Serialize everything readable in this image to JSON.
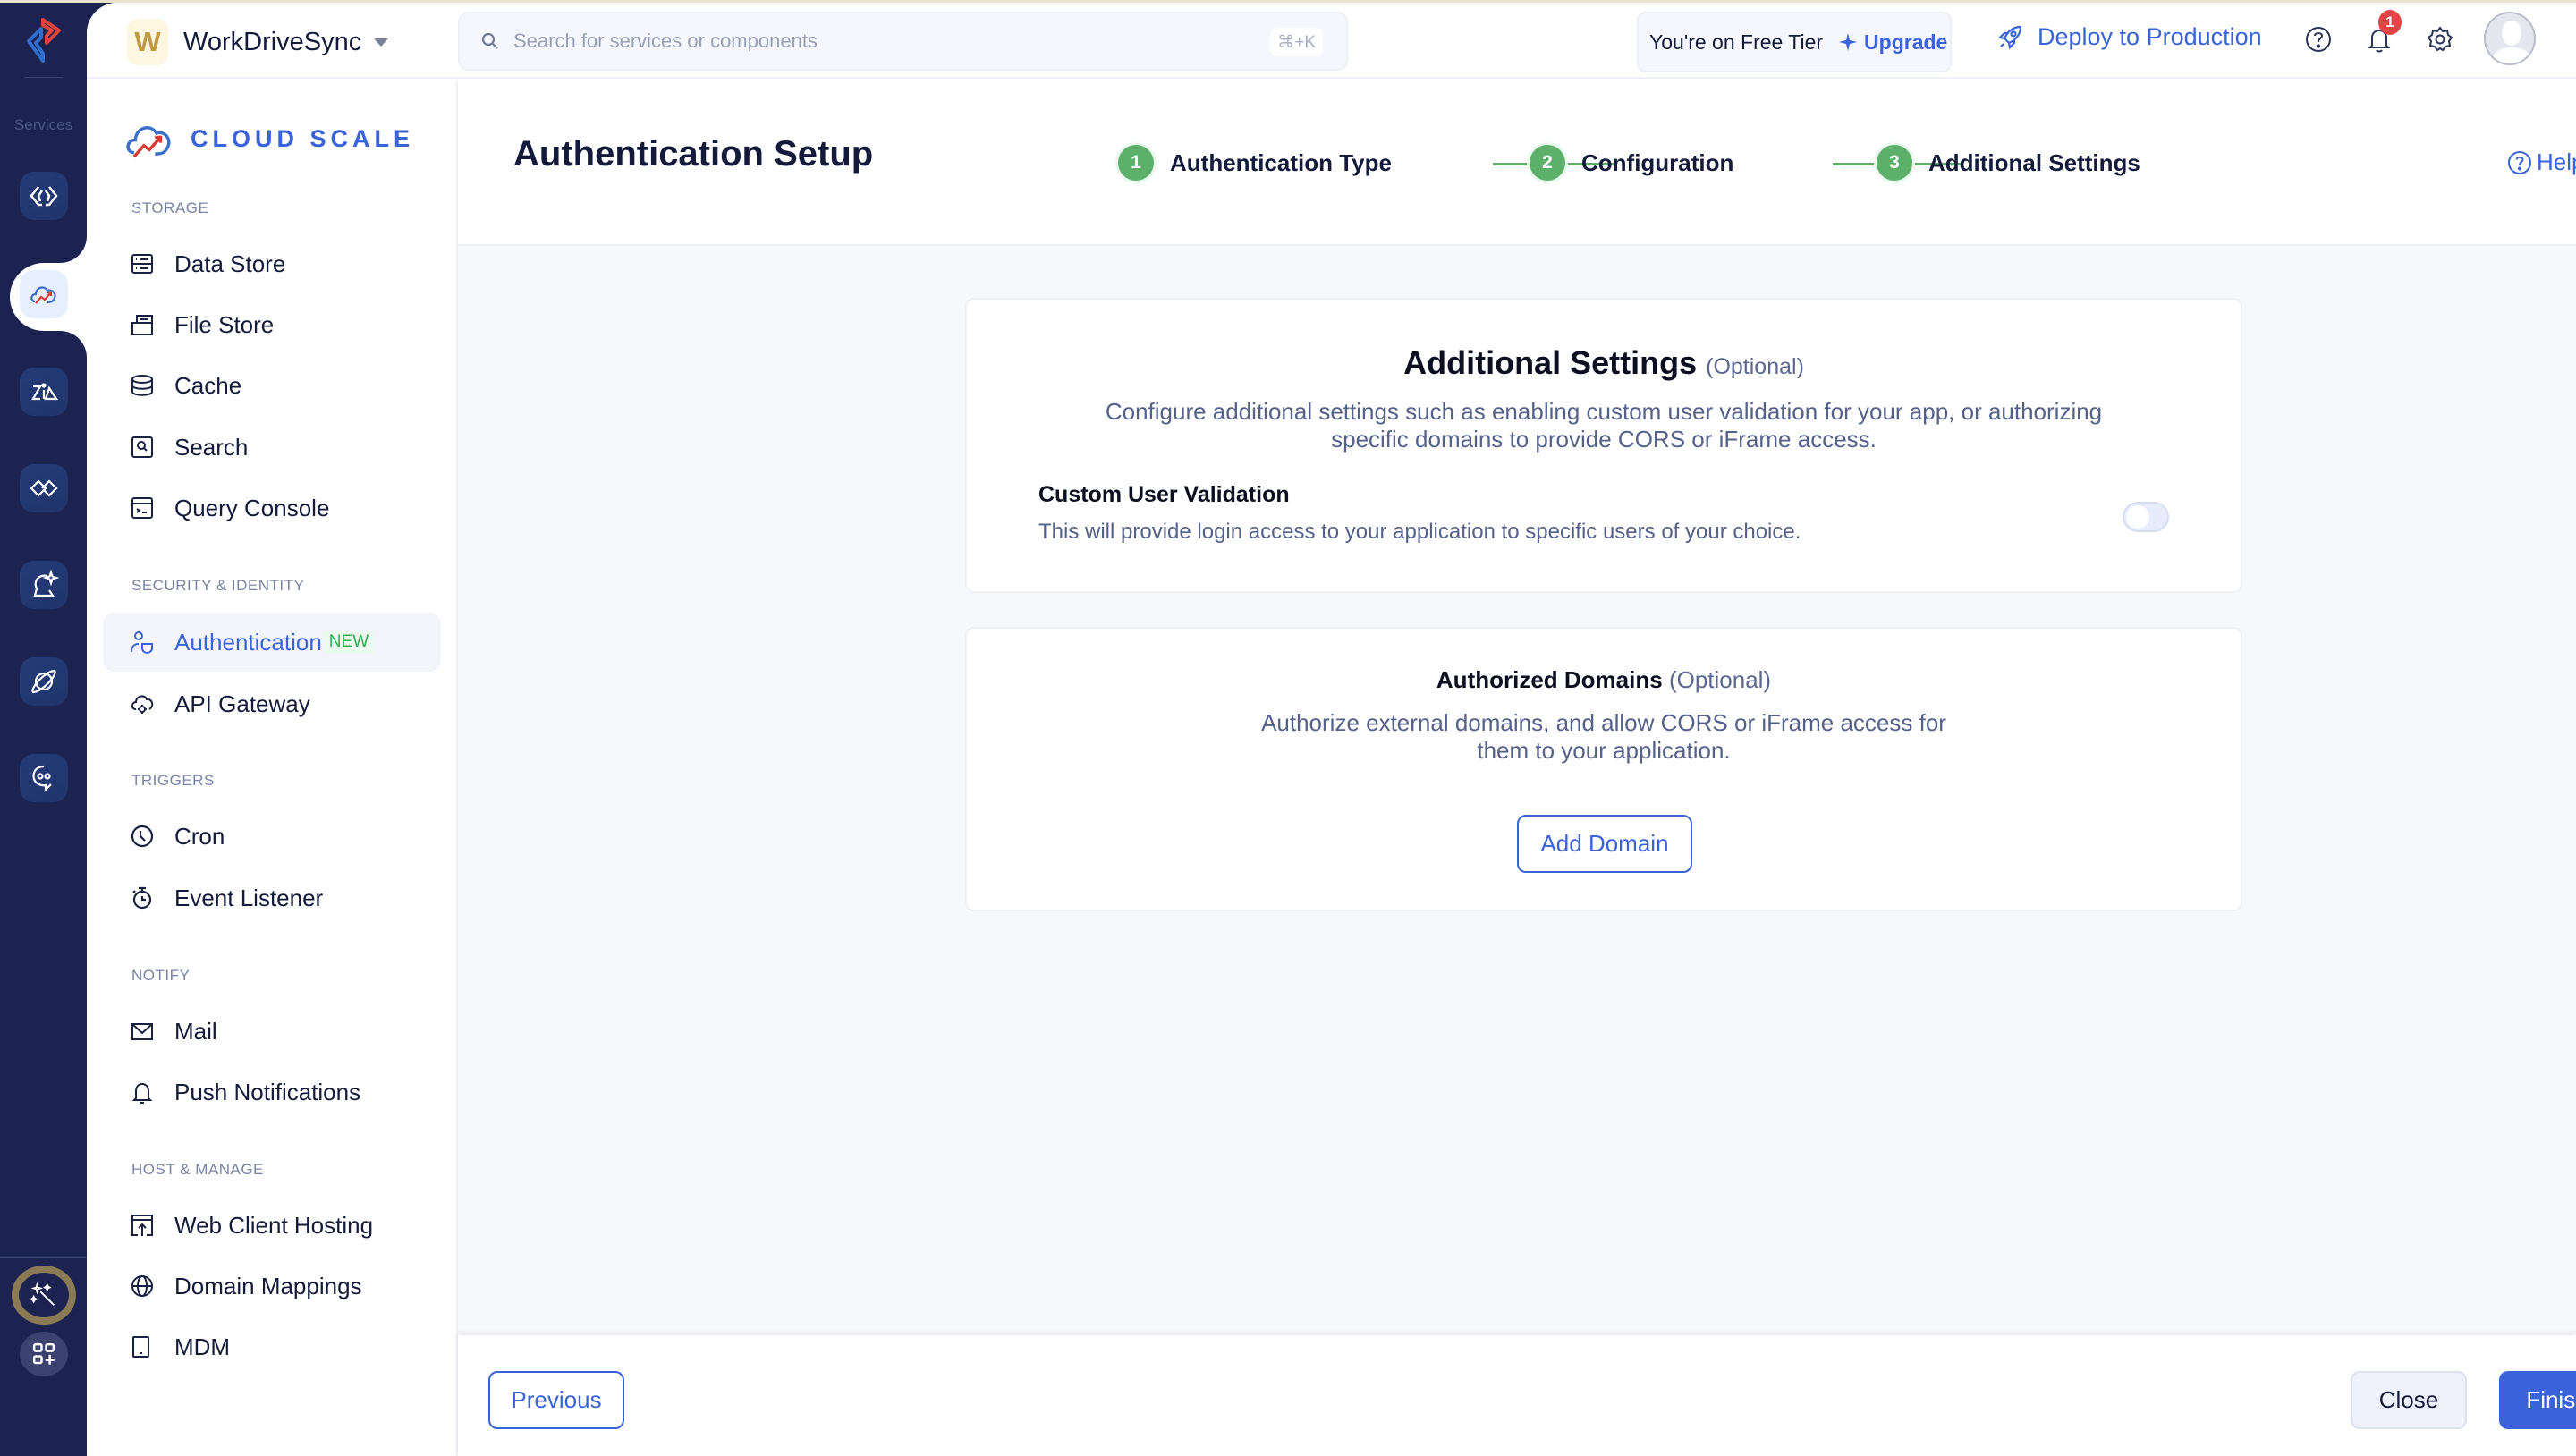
{
  "rail": {
    "services_label": "Services",
    "items": [
      {
        "name": "functions",
        "icon": "code-brackets-icon"
      },
      {
        "name": "cloud-scale",
        "icon": "cloud-scale-icon",
        "active": true
      },
      {
        "name": "zia",
        "icon": "zia-icon"
      },
      {
        "name": "integrations",
        "icon": "handshake-icon"
      },
      {
        "name": "quickml",
        "icon": "ai-sparkle-icon"
      },
      {
        "name": "devops",
        "icon": "planet-icon"
      },
      {
        "name": "signals",
        "icon": "chat-bot-icon"
      }
    ],
    "bottom": [
      {
        "name": "magic-wand",
        "icon": "magic-wand-icon"
      },
      {
        "name": "apps",
        "icon": "apps-add-icon"
      }
    ]
  },
  "header": {
    "project_initial": "W",
    "project_name": "WorkDriveSync",
    "search_placeholder": "Search for services or components",
    "search_shortcut": "⌘+K",
    "tier_text": "You're on Free Tier",
    "upgrade_label": "Upgrade",
    "deploy_label": "Deploy to Production",
    "notification_count": "1"
  },
  "sidebar": {
    "brand": "CLOUD SCALE",
    "sections": [
      {
        "label": "STORAGE",
        "items": [
          {
            "label": "Data Store",
            "icon": "data-store-icon"
          },
          {
            "label": "File Store",
            "icon": "file-store-icon"
          },
          {
            "label": "Cache",
            "icon": "cache-icon"
          },
          {
            "label": "Search",
            "icon": "search-box-icon"
          },
          {
            "label": "Query Console",
            "icon": "console-icon"
          }
        ]
      },
      {
        "label": "SECURITY & IDENTITY",
        "items": [
          {
            "label": "Authentication",
            "icon": "user-shield-icon",
            "badge": "NEW",
            "active": true
          },
          {
            "label": "API Gateway",
            "icon": "cloud-gear-icon"
          }
        ]
      },
      {
        "label": "TRIGGERS",
        "items": [
          {
            "label": "Cron",
            "icon": "clock-icon"
          },
          {
            "label": "Event Listener",
            "icon": "stopwatch-icon"
          }
        ]
      },
      {
        "label": "NOTIFY",
        "items": [
          {
            "label": "Mail",
            "icon": "mail-icon"
          },
          {
            "label": "Push Notifications",
            "icon": "bell-icon"
          }
        ]
      },
      {
        "label": "HOST & MANAGE",
        "items": [
          {
            "label": "Web Client Hosting",
            "icon": "upload-window-icon"
          },
          {
            "label": "Domain Mappings",
            "icon": "globe-icon"
          },
          {
            "label": "MDM",
            "icon": "tablet-icon"
          }
        ]
      }
    ]
  },
  "main": {
    "title": "Authentication Setup",
    "steps": [
      {
        "number": "1",
        "label": "Authentication Type",
        "status": "complete"
      },
      {
        "number": "2",
        "label": "Configuration",
        "status": "complete"
      },
      {
        "number": "3",
        "label": "Additional Settings",
        "status": "current"
      }
    ],
    "help_label": "Help",
    "additional_settings": {
      "title": "Additional Settings",
      "optional": "(Optional)",
      "description_line1": "Configure additional settings such as enabling custom user validation for your app, or authorizing",
      "description_line2": "specific domains to provide CORS or iFrame access.",
      "custom_validation_title": "Custom User Validation",
      "custom_validation_desc": "This will provide login access to your application to specific users of your choice.",
      "custom_validation_enabled": false
    },
    "authorized_domains": {
      "title": "Authorized Domains",
      "optional": "(Optional)",
      "description_line1": "Authorize external domains, and allow CORS or iFrame access for",
      "description_line2": "them to your application.",
      "add_button": "Add Domain"
    },
    "footer": {
      "previous": "Previous",
      "close": "Close",
      "finish": "Finish"
    }
  },
  "colors": {
    "accent": "#3b63d9",
    "rail_bg": "#1c2350",
    "step_complete": "#5cb06a",
    "new_badge": "#35a957",
    "notification": "#e04444"
  }
}
